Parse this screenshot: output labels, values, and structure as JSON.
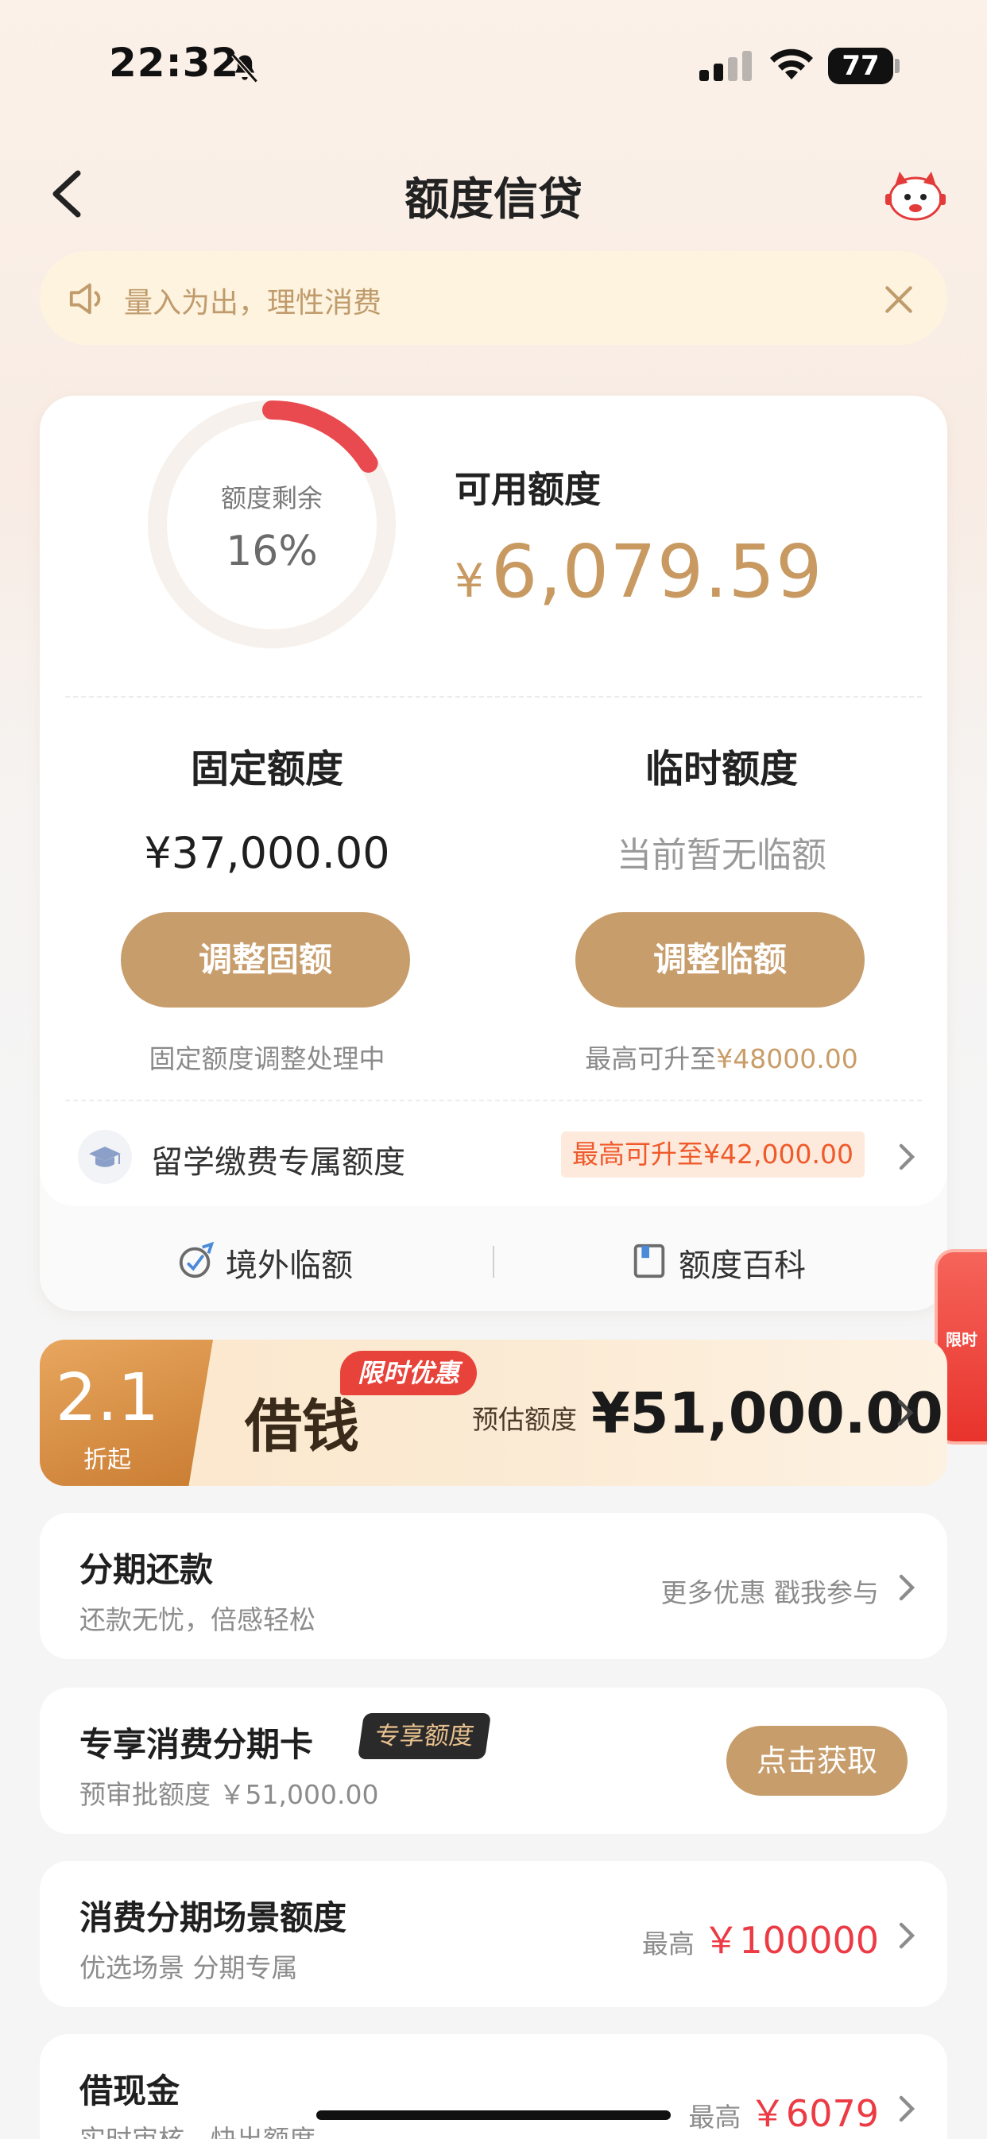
{
  "status_bar": {
    "time": "22:32",
    "battery": "77"
  },
  "nav": {
    "title": "额度信贷"
  },
  "notice": {
    "text": "量入为出，理性消费"
  },
  "credit": {
    "ring_label": "额度剩余",
    "ring_percent_text": "16%",
    "ring_percent": 16,
    "available_label": "可用额度",
    "available_currency": "¥",
    "available_amount": "6,079.59",
    "fixed": {
      "title": "固定额度",
      "amount": "¥37,000.00",
      "button": "调整固额",
      "hint": "固定额度调整处理中"
    },
    "temporary": {
      "title": "临时额度",
      "status": "当前暂无临额",
      "button": "调整临额",
      "hint_prefix": "最高可升至",
      "hint_amount": "¥48000.00"
    },
    "study": {
      "label": "留学缴费专属额度",
      "badge": "最高可升至¥42,000.00"
    },
    "links": {
      "overseas": "境外临额",
      "wiki": "额度百科"
    }
  },
  "side_tab": {
    "text": "限时"
  },
  "loan": {
    "rate": "2.1",
    "rate_sub": "折起",
    "title": "借钱",
    "badge": "限时优惠",
    "estimate_label": "预估额度",
    "estimate_amount": "¥51,000.00"
  },
  "installment": {
    "title": "分期还款",
    "subtitle": "还款无忧，倍感轻松",
    "right": "更多优惠 戳我参与"
  },
  "consume_card": {
    "title": "专享消费分期卡",
    "badge": "专享额度",
    "subtitle": "预审批额度 ￥51,000.00",
    "button": "点击获取"
  },
  "scene": {
    "title": "消费分期场景额度",
    "subtitle": "优选场景 分期专属",
    "right_label": "最高",
    "right_amount": "￥100000"
  },
  "cash": {
    "title": "借现金",
    "subtitle": "实时审核，快出额度",
    "right_label": "最高",
    "right_amount": "￥6079"
  },
  "colors": {
    "gold": "#c79d6c",
    "red": "#ec3b44",
    "ring_red": "#e94a4f"
  }
}
